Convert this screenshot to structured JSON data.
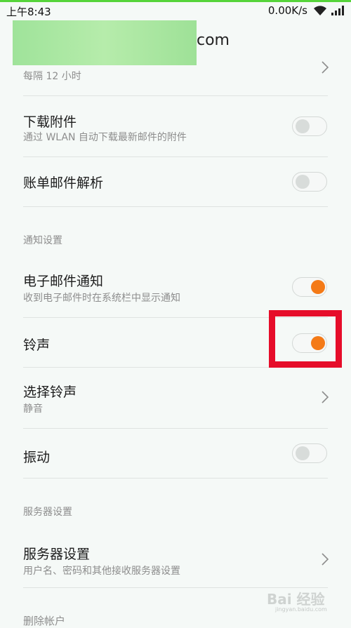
{
  "status_bar": {
    "time": "上午8:43",
    "network_speed": "0.00K/s",
    "wifi_icon": "wifi-icon",
    "signal_icon": "signal-icon"
  },
  "header": {
    "title_suffix": "com"
  },
  "settings": {
    "sync_interval": {
      "subtitle": "每隔 12 小时",
      "icon": "chevron-right-icon"
    },
    "download_attachments": {
      "title": "下载附件",
      "subtitle": "通过 WLAN 自动下载最新邮件的附件",
      "enabled": false
    },
    "bill_parsing": {
      "title": "账单邮件解析",
      "enabled": false
    },
    "notification_section": {
      "label": "通知设置"
    },
    "email_notification": {
      "title": "电子邮件通知",
      "subtitle": "收到电子邮件时在系统栏中显示通知",
      "enabled": true
    },
    "ringtone_toggle": {
      "title": "铃声",
      "enabled": true
    },
    "choose_ringtone": {
      "title": "选择铃声",
      "subtitle": "静音",
      "icon": "chevron-right-icon"
    },
    "vibrate": {
      "title": "振动",
      "enabled": false
    },
    "server_section": {
      "label": "服务器设置"
    },
    "server_settings": {
      "title": "服务器设置",
      "subtitle": "用户名、密码和其他接收服务器设置",
      "icon": "chevron-right-icon"
    },
    "delete_account": {
      "title": "删除帐户"
    }
  },
  "colors": {
    "accent_orange": "#f47a17",
    "highlight_red": "#e60d2a",
    "background": "#f5f9f7"
  },
  "watermark": {
    "text": "Bai 经验",
    "sub": "jingyan.baidu.com"
  }
}
